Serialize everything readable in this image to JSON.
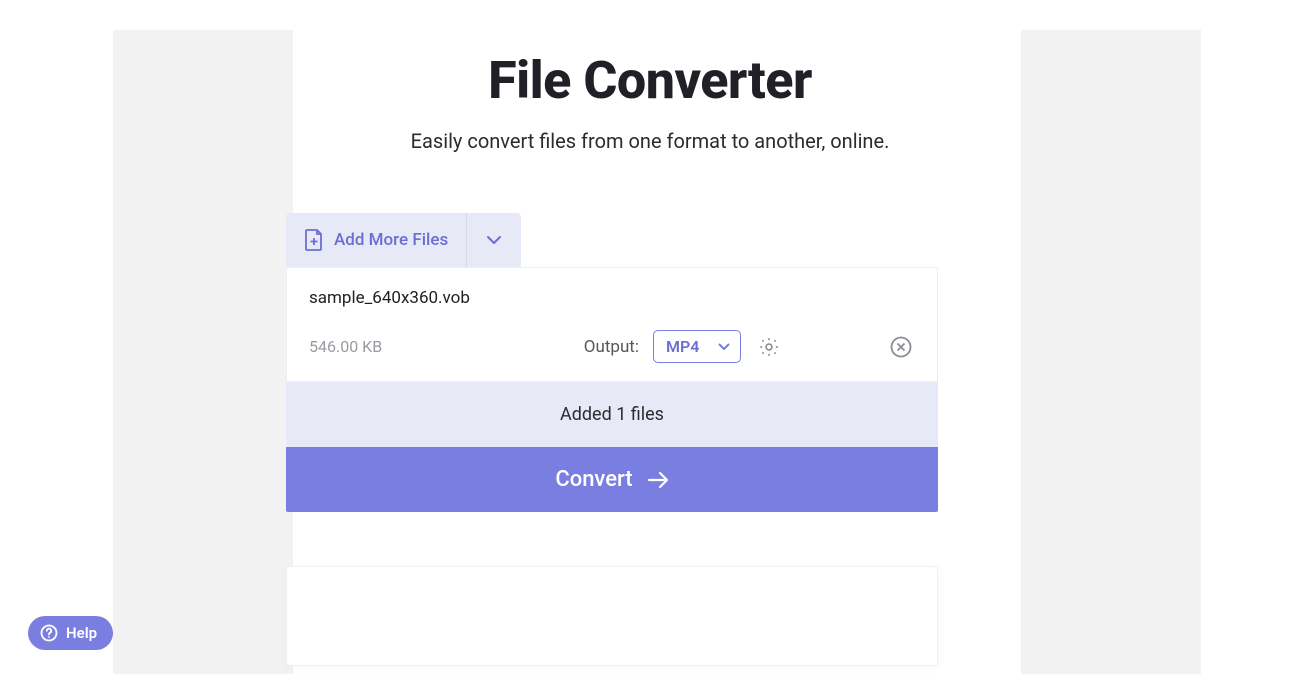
{
  "header": {
    "title": "File Converter",
    "subtitle": "Easily convert files from one format to another, online."
  },
  "add_files": {
    "label": "Add More Files"
  },
  "file": {
    "name": "sample_640x360.vob",
    "size": "546.00 KB",
    "output_label": "Output:",
    "output_format": "MP4"
  },
  "status": {
    "text": "Added 1 files"
  },
  "actions": {
    "convert": "Convert"
  },
  "help": {
    "label": "Help"
  }
}
